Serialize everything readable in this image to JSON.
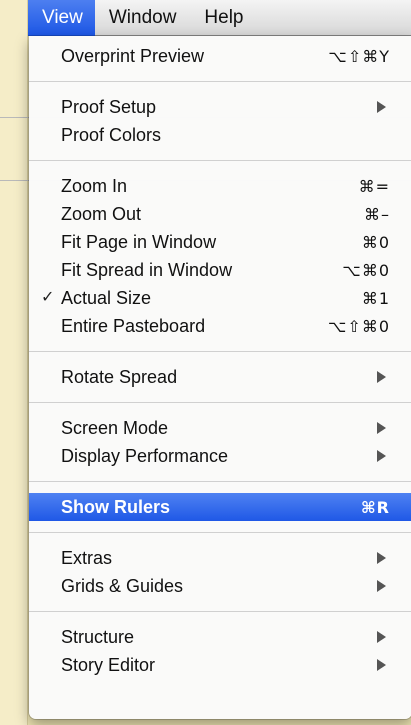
{
  "menubar": {
    "items": [
      {
        "label": "View",
        "active": true
      },
      {
        "label": "Window"
      },
      {
        "label": "Help"
      }
    ]
  },
  "menu": {
    "overprint_preview": {
      "label": "Overprint Preview",
      "shortcut": "⌥⇧⌘Y"
    },
    "proof_setup": {
      "label": "Proof Setup"
    },
    "proof_colors": {
      "label": "Proof Colors"
    },
    "zoom_in": {
      "label": "Zoom In",
      "shortcut": "⌘="
    },
    "zoom_out": {
      "label": "Zoom Out",
      "shortcut": "⌘–"
    },
    "fit_page": {
      "label": "Fit Page in Window",
      "shortcut": "⌘0"
    },
    "fit_spread": {
      "label": "Fit Spread in Window",
      "shortcut": "⌥⌘0"
    },
    "actual_size": {
      "label": "Actual Size",
      "shortcut": "⌘1",
      "checked": true,
      "check_glyph": "✓"
    },
    "entire_pasteboard": {
      "label": "Entire Pasteboard",
      "shortcut": "⌥⇧⌘0"
    },
    "rotate_spread": {
      "label": "Rotate Spread"
    },
    "screen_mode": {
      "label": "Screen Mode"
    },
    "display_performance": {
      "label": "Display Performance"
    },
    "show_rulers": {
      "label": "Show Rulers",
      "shortcut": "⌘R",
      "highlighted": true
    },
    "extras": {
      "label": "Extras"
    },
    "grids_guides": {
      "label": "Grids & Guides"
    },
    "structure": {
      "label": "Structure"
    },
    "story_editor": {
      "label": "Story Editor"
    }
  },
  "colors": {
    "highlight": "#2a62e8",
    "menu_background": "#fafafa",
    "window_background": "#efe6b4"
  }
}
